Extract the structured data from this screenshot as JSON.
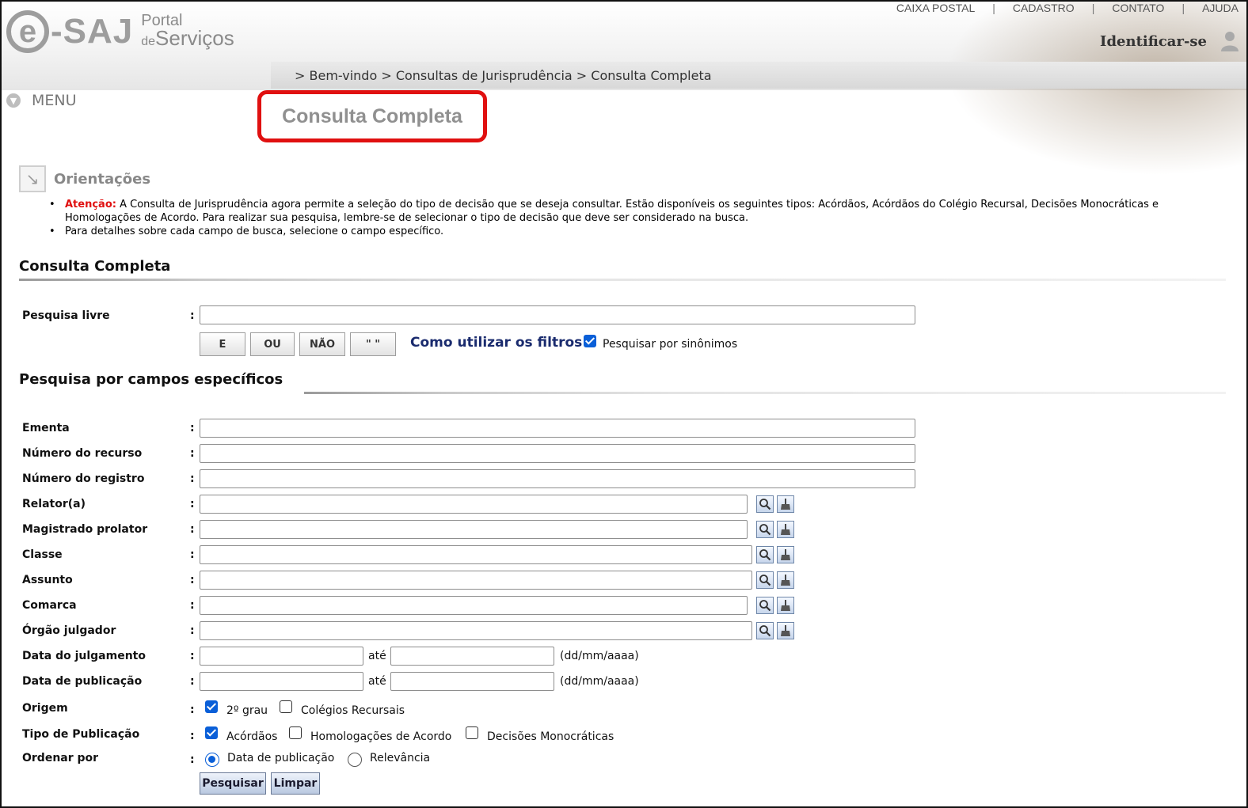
{
  "header": {
    "logo_e": "e",
    "logo_saj": "-SAJ",
    "logo_portal": "Portal",
    "logo_de": "de",
    "logo_servicos": "Serviços",
    "top_links": [
      "CAIXA POSTAL",
      "CADASTRO",
      "CONTATO",
      "AJUDA"
    ],
    "identify": "Identificar-se",
    "breadcrumb": "> Bem-vindo > Consultas de Jurisprudência > Consulta Completa"
  },
  "menu": {
    "label": "MENU"
  },
  "page_title": "Consulta Completa",
  "orientacoes": {
    "title": "Orientações",
    "warning_label": "Atenção:",
    "item1_text": " A Consulta de Jurisprudência agora permite a seleção do tipo de decisão que se deseja consultar. Estão disponíveis os seguintes tipos: Acórdãos, Acórdãos do Colégio Recursal, Decisões Monocráticas e Homologações de Acordo. Para realizar sua pesquisa, lembre-se de selecionar o tipo de decisão que deve ser considerado na busca.",
    "item2_text": "Para detalhes sobre cada campo de busca, selecione o campo específico."
  },
  "consulta": {
    "heading": "Consulta Completa",
    "free_search_label": "Pesquisa livre",
    "free_search_value": "",
    "operators": [
      "E",
      "OU",
      "NÃO",
      "\" \""
    ],
    "filters_link": "Como utilizar os filtros",
    "synonyms_label": "Pesquisar por sinônimos",
    "synonyms_checked": true
  },
  "specific": {
    "heading": "Pesquisa por campos específicos",
    "fields": {
      "ementa": "Ementa",
      "numero_recurso": "Número do recurso",
      "numero_registro": "Número do registro",
      "relator": "Relator(a)",
      "magistrado": "Magistrado prolator",
      "classe": "Classe",
      "assunto": "Assunto",
      "comarca": "Comarca",
      "orgao": "Órgão julgador",
      "data_julgamento": "Data do julgamento",
      "data_publicacao": "Data de publicação",
      "origem": "Origem",
      "tipo_publicacao": "Tipo de Publicação",
      "ordenar": "Ordenar por"
    },
    "colon": ":",
    "ate": "até",
    "date_format": "(dd/mm/aaaa)",
    "origem_options": [
      {
        "label": "2º grau",
        "checked": true
      },
      {
        "label": "Colégios Recursais",
        "checked": false
      }
    ],
    "tipo_options": [
      {
        "label": "Acórdãos",
        "checked": true
      },
      {
        "label": "Homologações de Acordo",
        "checked": false
      },
      {
        "label": "Decisões Monocráticas",
        "checked": false
      }
    ],
    "ordenar_options": [
      {
        "label": "Data de publicação",
        "selected": true
      },
      {
        "label": "Relevância",
        "selected": false
      }
    ]
  },
  "actions": {
    "search": "Pesquisar",
    "clear": "Limpar"
  },
  "colors": {
    "highlight": "#e01010",
    "link": "#1a2b6e",
    "checkbox": "#0a5fd8"
  }
}
